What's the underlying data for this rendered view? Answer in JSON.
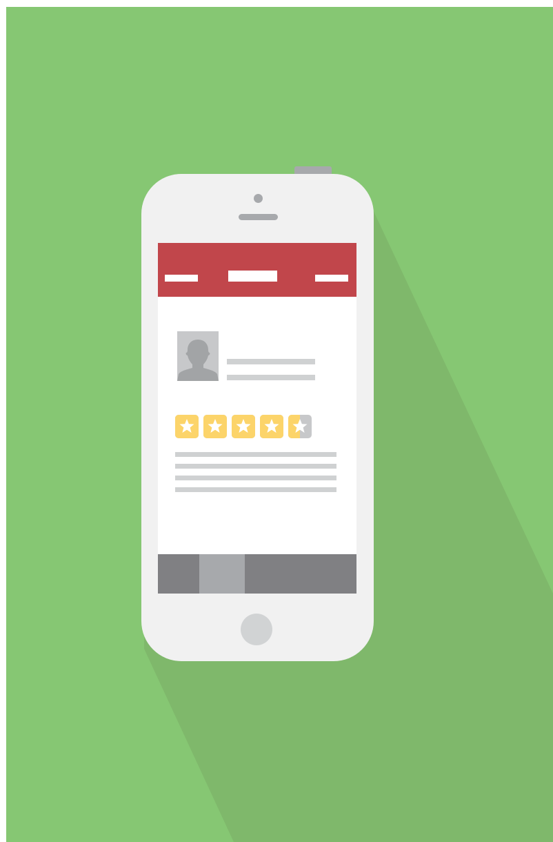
{
  "colors": {
    "background": "#86C773",
    "shadow": "#7FB86B",
    "phone_body": "#F1F1F1",
    "phone_details": "#A7A9AC",
    "home_button": "#D1D3D4",
    "header_bar": "#C1464B",
    "header_items": "#FFFFFF",
    "screen_content": "#FFFFFF",
    "avatar_bg": "#C7C8CA",
    "avatar_silhouette": "#A2A4A6",
    "placeholder_lines": "#CFD1D2",
    "star_filled": "#FCD46A",
    "star_empty": "#C7C8CA",
    "star_glyph": "#FFFFFF",
    "tab_bar": "#808083",
    "tab_active": "#A7A9AC"
  },
  "app": {
    "header": {
      "left_icon": "menu-placeholder-icon",
      "right_icon": "action-placeholder-icon"
    },
    "profile": {
      "avatar_icon": "user-silhouette-icon"
    },
    "review": {
      "rating": 4.5,
      "rating_max": 5,
      "star_icon": "star-icon"
    },
    "tab_bar": {
      "tab_count": 4,
      "active_tab_index": 1
    }
  }
}
